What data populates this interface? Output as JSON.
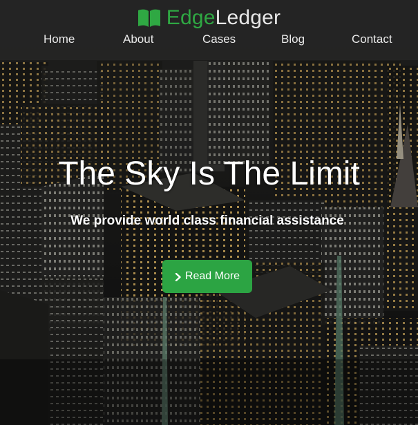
{
  "brand": {
    "name_part1": "Edge",
    "name_part2": "Ledger",
    "icon": "open-book-icon"
  },
  "nav": {
    "items": [
      {
        "label": "Home"
      },
      {
        "label": "About"
      },
      {
        "label": "Cases"
      },
      {
        "label": "Blog"
      },
      {
        "label": "Contact"
      }
    ]
  },
  "hero": {
    "title": "The Sky Is The Limit",
    "subtitle": "We provide world class financial assistance",
    "cta_label": "Read More",
    "cta_icon": "chevron-right-icon",
    "background": "night-city-skyline"
  },
  "colors": {
    "accent": "#2ca443",
    "header_bg": "#262626",
    "text": "#ffffff"
  }
}
